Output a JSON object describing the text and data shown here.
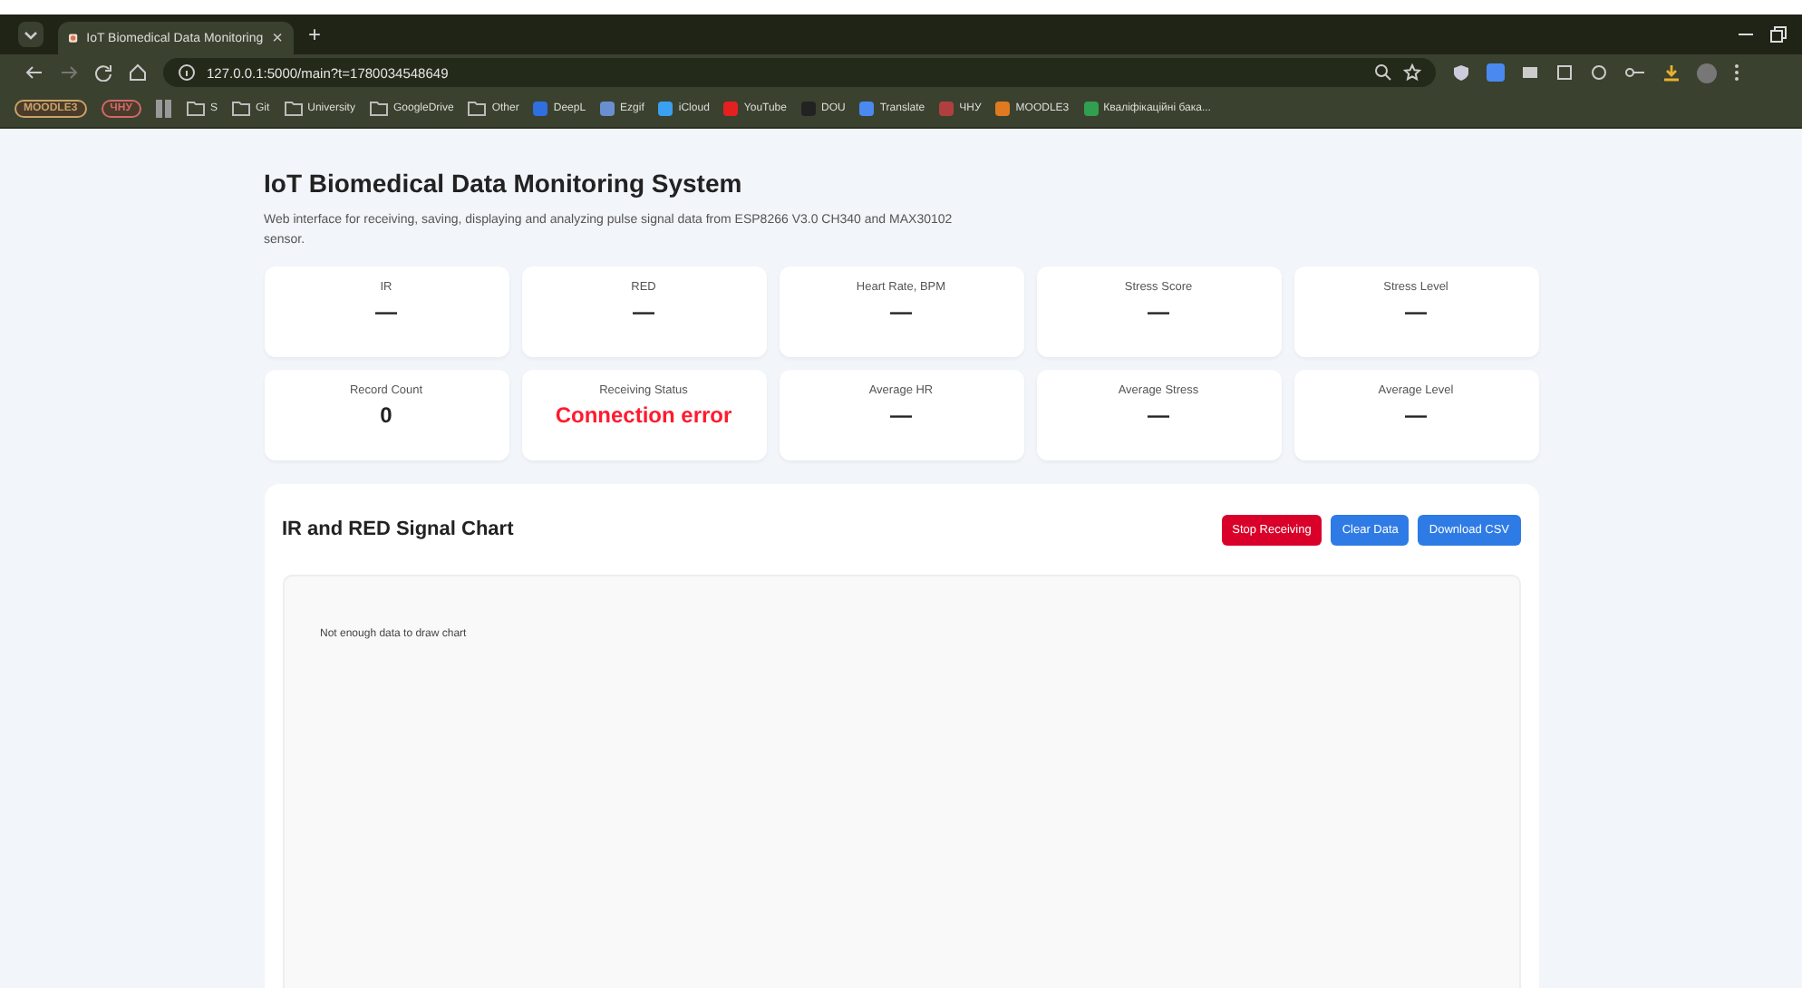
{
  "browser": {
    "tab": {
      "title": "IoT Biomedical Data Monitoring",
      "close": "×"
    },
    "new_tab": "+",
    "address": "127.0.0.1:5000/main?t=1780034548649",
    "bookmarks": [
      {
        "kind": "chip",
        "label": "MOODLE3",
        "color": "#c9a36a"
      },
      {
        "kind": "chip",
        "label": "ЧНУ",
        "color": "#d06a6a"
      },
      {
        "kind": "folder",
        "label": "S"
      },
      {
        "kind": "folder",
        "label": "Git"
      },
      {
        "kind": "folder",
        "label": "University"
      },
      {
        "kind": "folder",
        "label": "GoogleDrive"
      },
      {
        "kind": "folder",
        "label": "Other"
      },
      {
        "kind": "site",
        "label": "DeepL",
        "color": "#2f6fe0"
      },
      {
        "kind": "site",
        "label": "Ezgif",
        "color": "#6a8fd0"
      },
      {
        "kind": "site",
        "label": "iCloud",
        "color": "#3aa0f0"
      },
      {
        "kind": "site",
        "label": "YouTube",
        "color": "#e52020"
      },
      {
        "kind": "site",
        "label": "DOU",
        "color": "#222222"
      },
      {
        "kind": "site",
        "label": "Translate",
        "color": "#4a8af0"
      },
      {
        "kind": "site",
        "label": "ЧНУ",
        "color": "#b04040"
      },
      {
        "kind": "site",
        "label": "MOODLE3",
        "color": "#e07a20"
      },
      {
        "kind": "site",
        "label": "Кваліфікаційні бака...",
        "color": "#30a050"
      }
    ]
  },
  "page": {
    "title": "IoT Biomedical Data Monitoring System",
    "description": "Web interface for receiving, saving, displaying and analyzing pulse signal data from ESP8266 V3.0 CH340 and MAX30102 sensor.",
    "stats": [
      {
        "label": "IR",
        "value": "—",
        "kind": "plain"
      },
      {
        "label": "RED",
        "value": "—",
        "kind": "plain"
      },
      {
        "label": "Heart Rate, BPM",
        "value": "—",
        "kind": "plain"
      },
      {
        "label": "Stress Score",
        "value": "—",
        "kind": "plain"
      },
      {
        "label": "Stress Level",
        "value": "—",
        "kind": "plain"
      },
      {
        "label": "Record Count",
        "value": "0",
        "kind": "plain"
      },
      {
        "label": "Receiving Status",
        "value": "Connection error",
        "kind": "error"
      },
      {
        "label": "Average HR",
        "value": "—",
        "kind": "plain"
      },
      {
        "label": "Average Stress",
        "value": "—",
        "kind": "plain"
      },
      {
        "label": "Average Level",
        "value": "—",
        "kind": "plain"
      }
    ],
    "chart_panel": {
      "title": "IR and RED Signal Chart",
      "buttons": [
        {
          "label": "Stop Receiving",
          "kind": "danger"
        },
        {
          "label": "Clear Data",
          "kind": "primary"
        },
        {
          "label": "Download CSV",
          "kind": "primary"
        }
      ],
      "message": "Not enough data to draw chart"
    }
  }
}
